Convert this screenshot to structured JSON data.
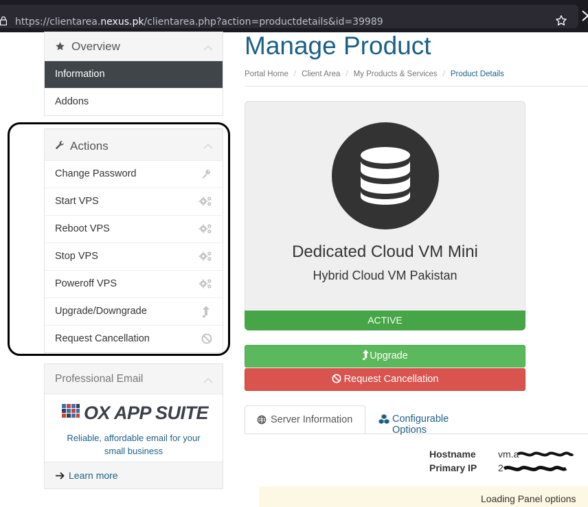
{
  "browser": {
    "url_prefix": "https://clientarea.",
    "url_host": "nexus.pk",
    "url_suffix": "/clientarea.php?action=productdetails&id=39989"
  },
  "sidebar": {
    "overview": {
      "title": "Overview",
      "items": [
        {
          "label": "Information",
          "active": true
        },
        {
          "label": "Addons",
          "active": false
        }
      ]
    },
    "actions": {
      "title": "Actions",
      "items": [
        {
          "label": "Change Password",
          "icon": "key-icon"
        },
        {
          "label": "Start VPS",
          "icon": "cogs-icon"
        },
        {
          "label": "Reboot VPS",
          "icon": "cogs-icon"
        },
        {
          "label": "Stop VPS",
          "icon": "cogs-icon"
        },
        {
          "label": "Poweroff VPS",
          "icon": "cogs-icon"
        },
        {
          "label": "Upgrade/Downgrade",
          "icon": "arrow-up-icon"
        },
        {
          "label": "Request Cancellation",
          "icon": "ban-icon"
        }
      ]
    },
    "email": {
      "title": "Professional Email",
      "logo_text": "OX APP SUITE",
      "description": "Reliable, affordable email for your small business",
      "learn_more": "Learn more"
    }
  },
  "main": {
    "title": "Manage Product",
    "breadcrumb": [
      "Portal Home",
      "Client Area",
      "My Products & Services",
      "Product Details"
    ],
    "product": {
      "name": "Dedicated Cloud VM Mini",
      "group": "Hybrid Cloud VM Pakistan",
      "status": "ACTIVE"
    },
    "buttons": {
      "upgrade": "Upgrade",
      "cancel": "Request Cancellation"
    },
    "tabs": [
      "Server Information",
      "Configurable Options"
    ],
    "server_info": {
      "hostname_label": "Hostname",
      "hostname_value": "vm.a",
      "ip_label": "Primary IP",
      "ip_value": "2"
    },
    "loading_text": "Loading Panel options"
  },
  "colors": {
    "primary": "#1b5f86",
    "success": "#46a546",
    "upgrade": "#5cb85c",
    "danger": "#d9534f",
    "active_nav": "#404549"
  }
}
